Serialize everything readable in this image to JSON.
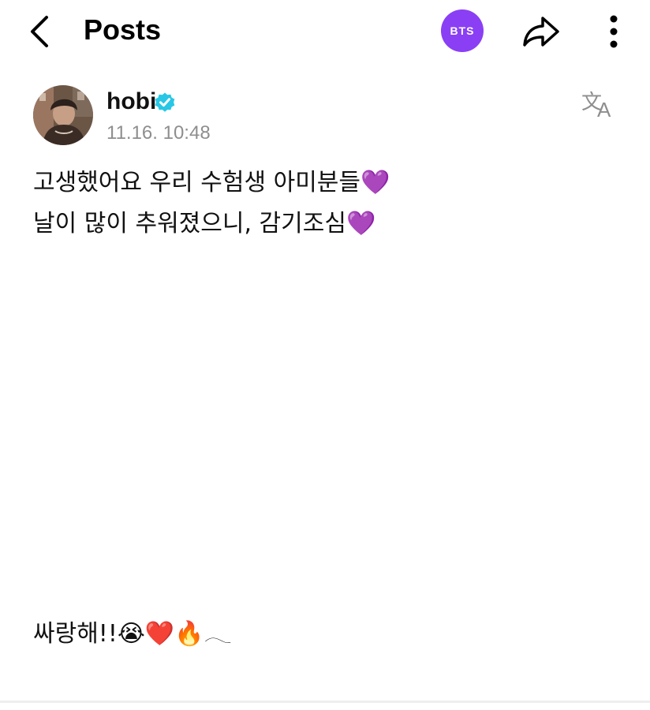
{
  "header": {
    "title": "Posts",
    "community_badge": "BTS",
    "icons": {
      "back": "chevron-left-icon",
      "share": "share-arrow-icon",
      "more": "more-vertical-icon"
    },
    "colors": {
      "badge_background": "#8a3ff5"
    }
  },
  "post": {
    "author": "hobi",
    "verified": true,
    "timestamp": "11.16. 10:48",
    "translate_icon": "translate-icon",
    "lines": [
      "고생했어요 우리 수험생 아미분들💜",
      "날이 많이 추워졌으니, 감기조심💜",
      "싸랑해!!😭❤️🔥𓂃"
    ],
    "colors": {
      "verified_badge": "#28c7e6",
      "timestamp_text": "#8e8e8e"
    }
  }
}
